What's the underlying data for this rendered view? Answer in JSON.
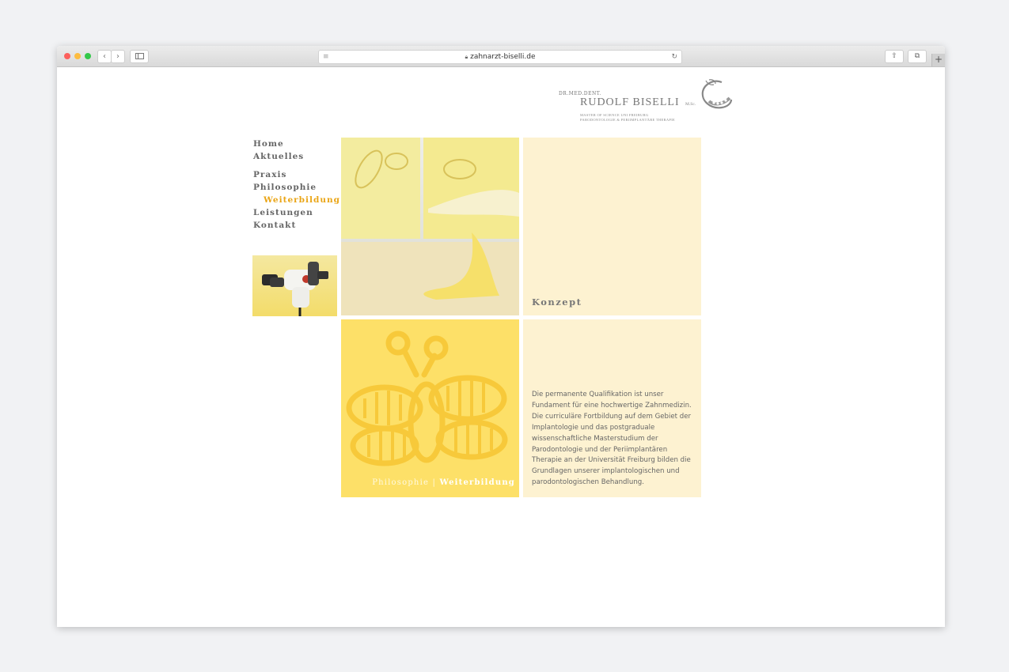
{
  "browser": {
    "url": "zahnarzt-biselli.de",
    "back": "‹",
    "forward": "›",
    "reload": "↻",
    "share": "⇧",
    "tabs": "⧉",
    "new_tab": "+"
  },
  "logo": {
    "prefix": "DR.MED.DENT.",
    "name": "RUDOLF BISELLI",
    "suffix": "M.Sc.",
    "line1": "MASTER OF SCIENCE UNI FREIBURG",
    "line2": "PARODONTOLOGIE & PERIIMPLANTÄRE THERAPIE"
  },
  "nav": {
    "items": [
      "Home",
      "Aktuelles",
      "Praxis",
      "Philosophie",
      "Weiterbildung",
      "Leistungen",
      "Kontakt"
    ],
    "active": "Weiterbildung"
  },
  "tiles": {
    "konzept_title": "Konzept",
    "caption_left": "Philosophie",
    "caption_sep": "|",
    "caption_right": "Weiterbildung",
    "body_text": "Die permanente Qualifikation ist unser Fundament für eine hochwertige Zahnmedizin. Die curriculäre Fortbildung auf dem Gebiet der Implantologie und das postgraduale wissenschaftliche Masterstudium der Parodontologie und der Periimplantären Therapie an der Universität Freiburg bilden die Grundlagen unserer implantologischen und parodontologischen Behandlung."
  },
  "colors": {
    "accent": "#eaa516",
    "tile_cream": "#fdf2d1",
    "tile_yellow": "#fde068",
    "nav_text": "#666666"
  },
  "icons": [
    "lines-icon",
    "lock-icon",
    "reload-icon",
    "share-icon",
    "tabs-icon",
    "sidebar-icon",
    "butterfly-logo-icon"
  ]
}
